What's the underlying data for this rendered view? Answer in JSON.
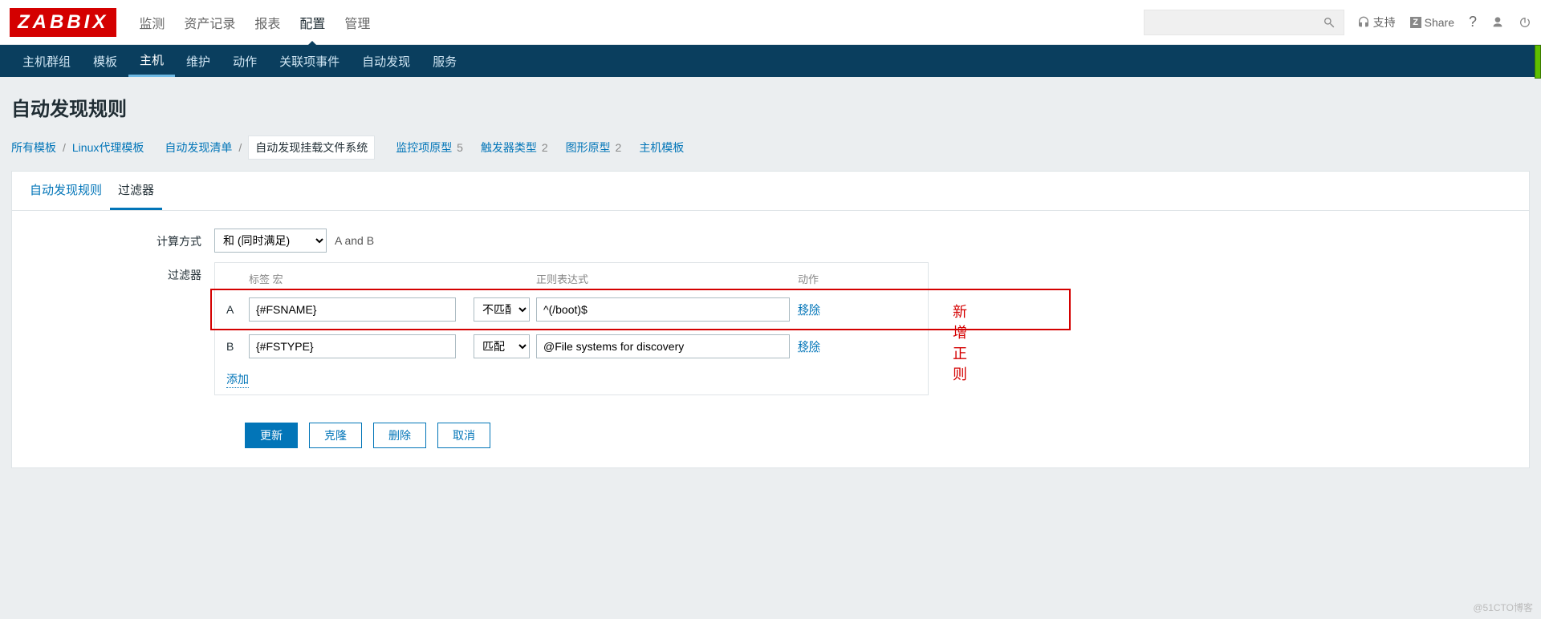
{
  "logo": "ZABBIX",
  "main_nav": {
    "items": [
      "监测",
      "资产记录",
      "报表",
      "配置",
      "管理"
    ],
    "active": 3
  },
  "header": {
    "support": "支持",
    "share": "Share",
    "question": "?"
  },
  "sub_nav": {
    "items": [
      "主机群组",
      "模板",
      "主机",
      "维护",
      "动作",
      "关联项事件",
      "自动发现",
      "服务"
    ],
    "active": 2
  },
  "page_title": "自动发现规则",
  "breadcrumb": {
    "all_templates": "所有模板",
    "template_name": "Linux代理模板",
    "discovery_list": "自动发现清单",
    "current": "自动发现挂载文件系统",
    "links": [
      {
        "label": "监控项原型",
        "count": "5"
      },
      {
        "label": "触发器类型",
        "count": "2"
      },
      {
        "label": "图形原型",
        "count": "2"
      },
      {
        "label": "主机模板",
        "count": ""
      }
    ]
  },
  "tabs": {
    "items": [
      "自动发现规则",
      "过滤器"
    ],
    "active": 1
  },
  "form": {
    "calc_label": "计算方式",
    "calc_select": "和 (同时满足)",
    "calc_hint": "A and B",
    "filter_label": "过滤器",
    "table": {
      "header": {
        "label_macro": "标签 宏",
        "regex": "正则表达式",
        "action": "动作"
      },
      "rows": [
        {
          "tag": "A",
          "macro": "{#FSNAME}",
          "op": "不匹配",
          "regex": "^(/boot)$",
          "action": "移除"
        },
        {
          "tag": "B",
          "macro": "{#FSTYPE}",
          "op": "匹配",
          "regex": "@File systems for discovery",
          "action": "移除"
        }
      ],
      "add": "添加"
    }
  },
  "annotation": "新增正则",
  "buttons": {
    "update": "更新",
    "clone": "克隆",
    "delete": "删除",
    "cancel": "取消"
  },
  "watermark": "@51CTO博客"
}
